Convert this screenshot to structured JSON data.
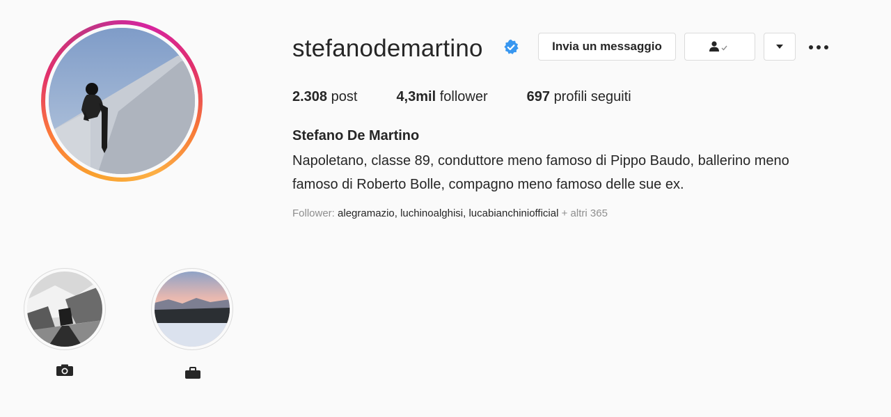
{
  "profile": {
    "username": "stefanodemartino",
    "verified": true,
    "full_name": "Stefano De Martino",
    "bio_line1": "Napoletano, classe 89, conduttore meno famoso di Pippo Baudo, ballerino meno",
    "bio_line2": "famoso di Roberto Bolle, compagno meno famoso delle sue ex."
  },
  "actions": {
    "message_label": "Invia un messaggio",
    "following_icon": "person-check-icon",
    "suggestions_icon": "caret-down-icon",
    "options_icon": "more-dots-icon"
  },
  "stats": {
    "posts_value": "2.308",
    "posts_label": "post",
    "followers_value": "4,3mil",
    "followers_label": "follower",
    "following_value": "697",
    "following_label": "profili seguiti"
  },
  "followed_by": {
    "prefix": "Follower:",
    "names": "alegramazio, luchinoalghisi, lucabianchiniofficial",
    "suffix": "+ altri 365"
  },
  "highlights": [
    {
      "icon": "camera-icon",
      "label": "📷"
    },
    {
      "icon": "briefcase-icon",
      "label": "💼"
    }
  ],
  "colors": {
    "verified_blue": "#3897f0",
    "text": "#262626",
    "muted": "#8e8e8e",
    "border": "#dbdbdb"
  }
}
